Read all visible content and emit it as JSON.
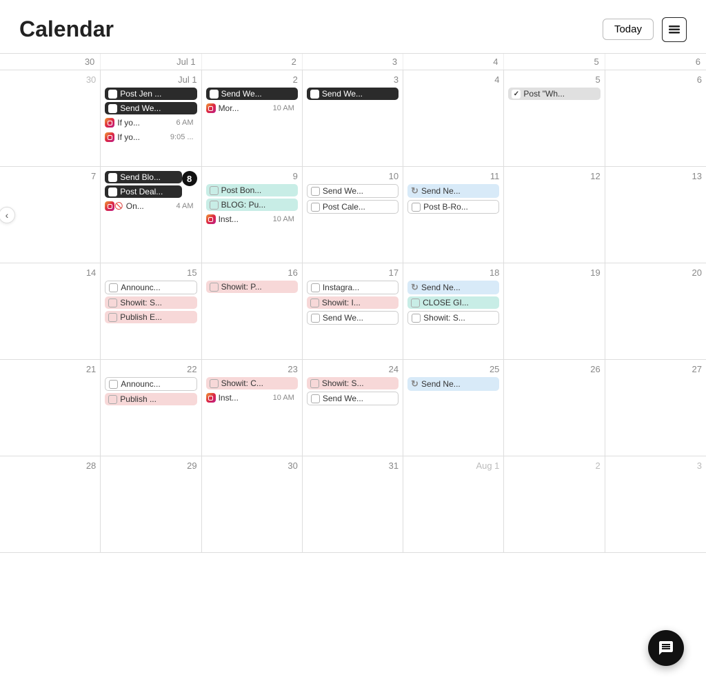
{
  "header": {
    "title": "Calendar",
    "today_btn": "Today",
    "list_icon": "list-icon"
  },
  "day_names": [
    "30",
    "Jul 1",
    "2",
    "3",
    "4",
    "5",
    "6"
  ],
  "weeks": [
    {
      "days": [
        {
          "num": "30",
          "style": "gray",
          "events": []
        },
        {
          "num": "Jul 1",
          "style": "normal",
          "events": [
            {
              "type": "dark-bg",
              "icon": "checkbox",
              "text": "Post Jen ...",
              "time": ""
            },
            {
              "type": "dark-bg",
              "icon": "checkbox",
              "text": "Send We...",
              "time": ""
            },
            {
              "type": "ig",
              "icon": "ig",
              "text": "If yo...",
              "time": "6 AM"
            },
            {
              "type": "ig",
              "icon": "ig",
              "text": "If yo...",
              "time": "9:05 ..."
            }
          ]
        },
        {
          "num": "2",
          "style": "normal",
          "events": [
            {
              "type": "dark-bg",
              "icon": "checkbox",
              "text": "Send We...",
              "time": ""
            },
            {
              "type": "ig",
              "icon": "ig",
              "text": "Mor...",
              "time": "10 AM"
            }
          ]
        },
        {
          "num": "3",
          "style": "normal",
          "events": [
            {
              "type": "dark-bg",
              "icon": "checkbox",
              "text": "Send We...",
              "time": ""
            }
          ]
        },
        {
          "num": "4",
          "style": "normal",
          "events": []
        },
        {
          "num": "5",
          "style": "normal",
          "events": [
            {
              "type": "gray-bg",
              "icon": "checkbox",
              "text": "Post \"Wh...",
              "time": ""
            }
          ]
        },
        {
          "num": "6",
          "style": "normal",
          "events": []
        }
      ]
    },
    {
      "days": [
        {
          "num": "7",
          "style": "normal",
          "events": []
        },
        {
          "num": "8",
          "style": "today",
          "events": [
            {
              "type": "dark-bg",
              "icon": "checkbox",
              "text": "Send Blo...",
              "time": ""
            },
            {
              "type": "dark-bg",
              "icon": "checkbox",
              "text": "Post Deal...",
              "time": ""
            },
            {
              "type": "ig-cancel",
              "icon": "ig-cancel",
              "text": "On...",
              "time": "4 AM"
            }
          ]
        },
        {
          "num": "9",
          "style": "normal",
          "events": [
            {
              "type": "teal-bg",
              "icon": "checkbox-empty",
              "text": "Post Bon...",
              "time": ""
            },
            {
              "type": "teal-bg",
              "icon": "checkbox-empty",
              "text": "BLOG: Pu...",
              "time": ""
            },
            {
              "type": "ig",
              "icon": "ig",
              "text": "Inst...",
              "time": "10 AM"
            }
          ]
        },
        {
          "num": "10",
          "style": "normal",
          "events": [
            {
              "type": "white-border",
              "icon": "checkbox-empty",
              "text": "Send We...",
              "time": ""
            },
            {
              "type": "white-border",
              "icon": "checkbox-empty",
              "text": "Post Cale...",
              "time": ""
            }
          ]
        },
        {
          "num": "11",
          "style": "normal",
          "events": [
            {
              "type": "blue-bg",
              "icon": "refresh",
              "text": "Send Ne...",
              "time": ""
            },
            {
              "type": "white-border",
              "icon": "checkbox-empty",
              "text": "Post B-Ro...",
              "time": ""
            }
          ]
        },
        {
          "num": "12",
          "style": "normal",
          "events": []
        },
        {
          "num": "13",
          "style": "normal",
          "events": []
        }
      ]
    },
    {
      "days": [
        {
          "num": "14",
          "style": "normal",
          "events": []
        },
        {
          "num": "15",
          "style": "normal",
          "events": [
            {
              "type": "white-border",
              "icon": "checkbox-empty",
              "text": "Announc...",
              "time": ""
            },
            {
              "type": "pink-bg",
              "icon": "checkbox-empty",
              "text": "Showit: S...",
              "time": ""
            },
            {
              "type": "pink-bg",
              "icon": "checkbox-empty",
              "text": "Publish E...",
              "time": ""
            }
          ]
        },
        {
          "num": "16",
          "style": "normal",
          "events": [
            {
              "type": "pink-bg",
              "icon": "checkbox-empty",
              "text": "Showit: P...",
              "time": ""
            }
          ]
        },
        {
          "num": "17",
          "style": "normal",
          "events": [
            {
              "type": "white-border",
              "icon": "checkbox-empty",
              "text": "Instagra...",
              "time": ""
            },
            {
              "type": "pink-bg",
              "icon": "checkbox-empty",
              "text": "Showit: I...",
              "time": ""
            },
            {
              "type": "white-border",
              "icon": "checkbox-empty",
              "text": "Send We...",
              "time": ""
            }
          ]
        },
        {
          "num": "18",
          "style": "normal",
          "events": [
            {
              "type": "blue-bg",
              "icon": "refresh",
              "text": "Send Ne...",
              "time": ""
            },
            {
              "type": "teal-bg",
              "icon": "checkbox-empty",
              "text": "CLOSE GI...",
              "time": ""
            },
            {
              "type": "white-border",
              "icon": "checkbox-empty",
              "text": "Showit: S...",
              "time": ""
            }
          ]
        },
        {
          "num": "19",
          "style": "normal",
          "events": []
        },
        {
          "num": "20",
          "style": "normal",
          "events": []
        }
      ]
    },
    {
      "days": [
        {
          "num": "21",
          "style": "normal",
          "events": []
        },
        {
          "num": "22",
          "style": "normal",
          "events": [
            {
              "type": "white-border",
              "icon": "checkbox-empty",
              "text": "Announc...",
              "time": ""
            },
            {
              "type": "pink-bg",
              "icon": "checkbox-empty",
              "text": "Publish ...",
              "time": ""
            }
          ]
        },
        {
          "num": "23",
          "style": "normal",
          "events": [
            {
              "type": "pink-bg",
              "icon": "checkbox-empty",
              "text": "Showit: C...",
              "time": ""
            },
            {
              "type": "ig",
              "icon": "ig",
              "text": "Inst...",
              "time": "10 AM"
            }
          ]
        },
        {
          "num": "24",
          "style": "normal",
          "events": [
            {
              "type": "pink-bg",
              "icon": "checkbox-empty",
              "text": "Showit: S...",
              "time": ""
            },
            {
              "type": "white-border",
              "icon": "checkbox-empty",
              "text": "Send We...",
              "time": ""
            }
          ]
        },
        {
          "num": "25",
          "style": "normal",
          "events": [
            {
              "type": "blue-bg",
              "icon": "refresh",
              "text": "Send Ne...",
              "time": ""
            }
          ]
        },
        {
          "num": "26",
          "style": "normal",
          "events": []
        },
        {
          "num": "27",
          "style": "normal",
          "events": []
        }
      ]
    },
    {
      "days": [
        {
          "num": "28",
          "style": "normal",
          "events": []
        },
        {
          "num": "29",
          "style": "normal",
          "events": []
        },
        {
          "num": "30",
          "style": "normal",
          "events": []
        },
        {
          "num": "31",
          "style": "normal",
          "events": []
        },
        {
          "num": "Aug 1",
          "style": "gray",
          "events": []
        },
        {
          "num": "2",
          "style": "gray",
          "events": []
        },
        {
          "num": "3",
          "style": "gray",
          "events": []
        }
      ]
    }
  ]
}
